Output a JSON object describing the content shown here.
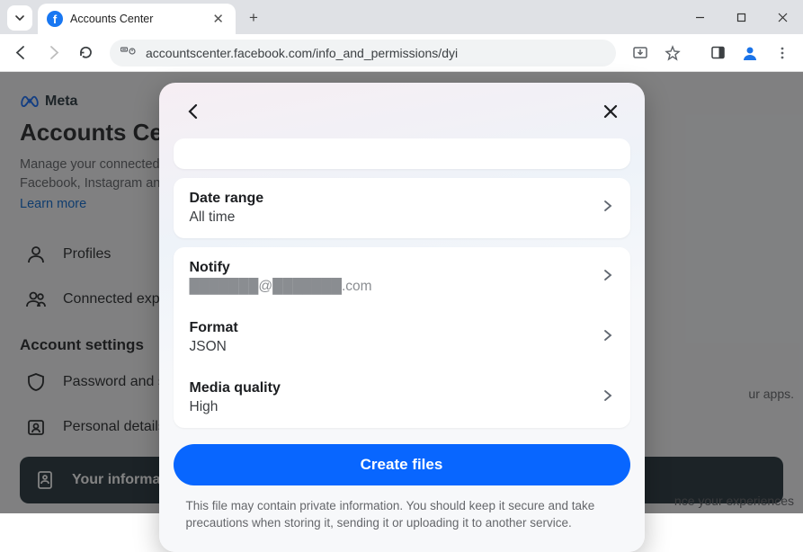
{
  "browser": {
    "tab_title": "Accounts Center",
    "url": "accountscenter.facebook.com/info_and_permissions/dyi"
  },
  "page": {
    "brand": "Meta",
    "title": "Accounts Center",
    "subtitle": "Manage your connected experiences and account settings across Meta technologies like Facebook, Instagram and more.",
    "learn_more": "Learn more",
    "nav": {
      "profiles": "Profiles",
      "connected": "Connected experiences"
    },
    "section": "Account settings",
    "settings": {
      "password": "Password and security",
      "personal": "Personal details",
      "info_perm": "Your information and permissions"
    },
    "bg_right": "ur apps.",
    "bg_bottom": "nce your experiences"
  },
  "modal": {
    "date_range": {
      "label": "Date range",
      "value": "All time"
    },
    "notify": {
      "label": "Notify",
      "value": "███████@███████.com"
    },
    "format": {
      "label": "Format",
      "value": "JSON"
    },
    "media": {
      "label": "Media quality",
      "value": "High"
    },
    "cta": "Create files",
    "disclaimer": "This file may contain private information. You should keep it secure and take precautions when storing it, sending it or uploading it to another service."
  }
}
